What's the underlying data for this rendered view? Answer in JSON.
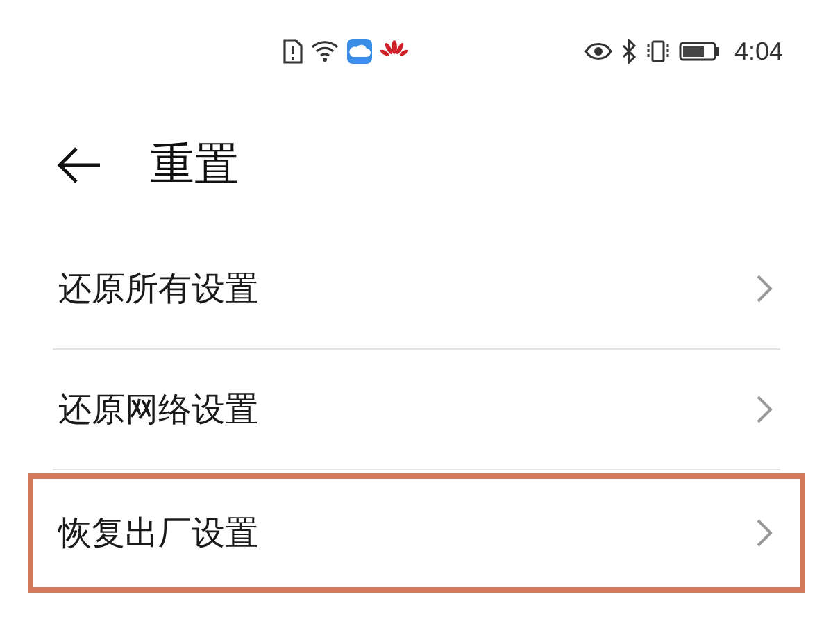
{
  "status_bar": {
    "time": "4:04"
  },
  "header": {
    "title": "重置"
  },
  "items": [
    {
      "label": "还原所有设置",
      "highlighted": false
    },
    {
      "label": "还原网络设置",
      "highlighted": false
    },
    {
      "label": "恢复出厂设置",
      "highlighted": true
    }
  ]
}
